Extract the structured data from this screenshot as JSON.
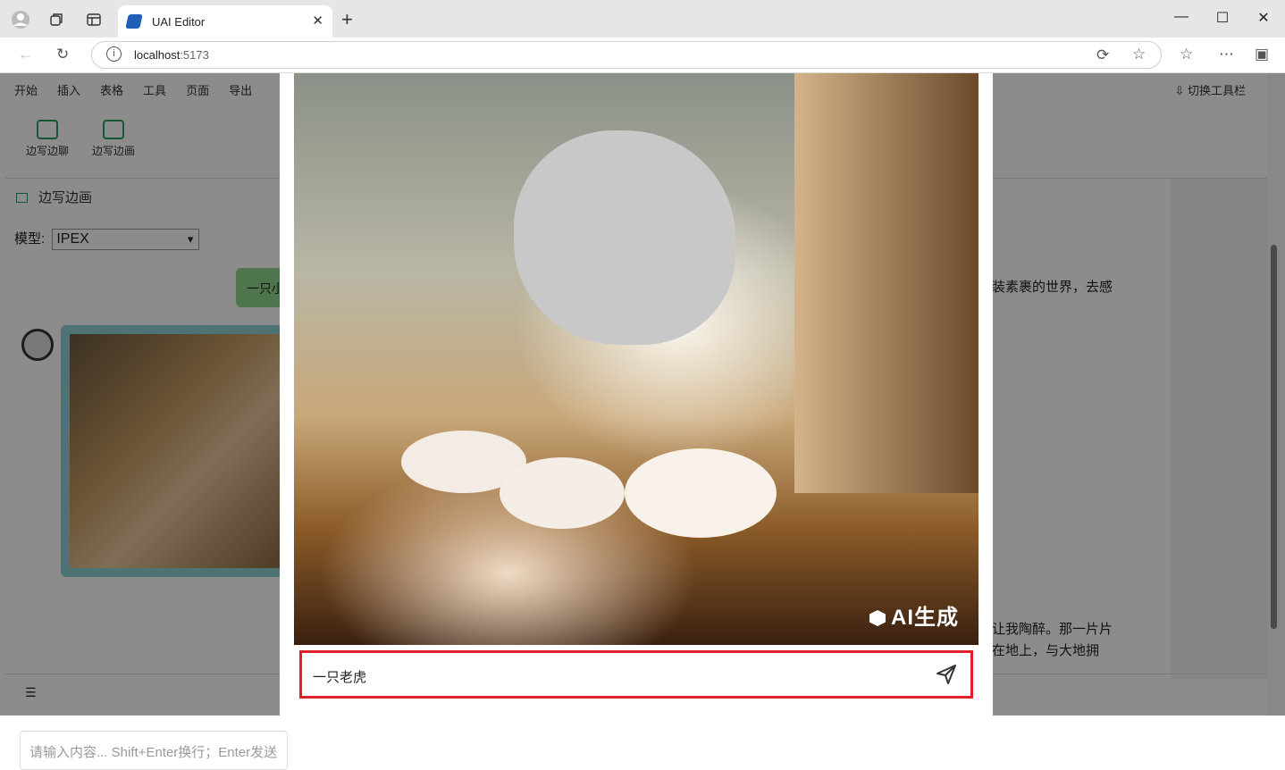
{
  "browser": {
    "tab_title": "UAI Editor",
    "url_host": "localhost",
    "url_port": ":5173"
  },
  "menu": {
    "items": [
      "开始",
      "插入",
      "表格",
      "工具",
      "页面",
      "导出"
    ],
    "toggle_toolbar": "切换工具栏"
  },
  "ribbon": {
    "chat_label": "边写边聊",
    "draw_label": "边写边画"
  },
  "panel": {
    "title": "边写边画",
    "model_label": "模型:",
    "model_value": "IPEX",
    "user_message": "一只小",
    "chat_placeholder": "请输入内容... Shift+Enter换行；Enter发送"
  },
  "document": {
    "line1": "装素裹的世界，去感",
    "line2": "让我陶醉。那一片片",
    "line3": "在地上，与大地拥"
  },
  "modal": {
    "ai_watermark": "AI生成",
    "prompt_value": "一只老虎"
  }
}
